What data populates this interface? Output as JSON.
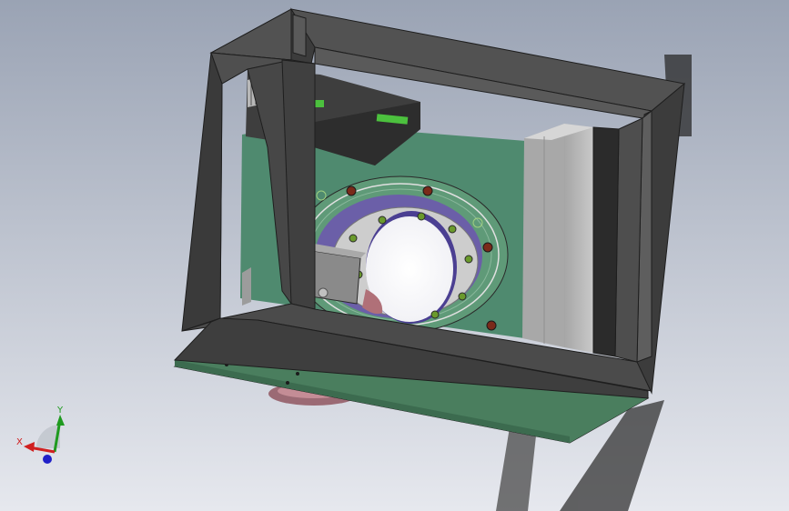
{
  "viewport": {
    "background_top": "#9aa3b4",
    "background_bottom": "#e6e8ee"
  },
  "model": {
    "frame_color": "#474747",
    "frame_edge": "#1e1e1e",
    "pcb_color": "#4f8a6f",
    "base_plate_color": "#4a7e5e",
    "motor_block_color": "#b9b9b9",
    "ring_color": "#cdcdcd",
    "bearing_color": "#6b5fa8",
    "connector_color": "#4cc13e"
  },
  "triad": {
    "x_label": "X",
    "y_label": "Y",
    "x_color": "#d02020",
    "y_color": "#1f9a1f",
    "z_color": "#2020c8"
  }
}
